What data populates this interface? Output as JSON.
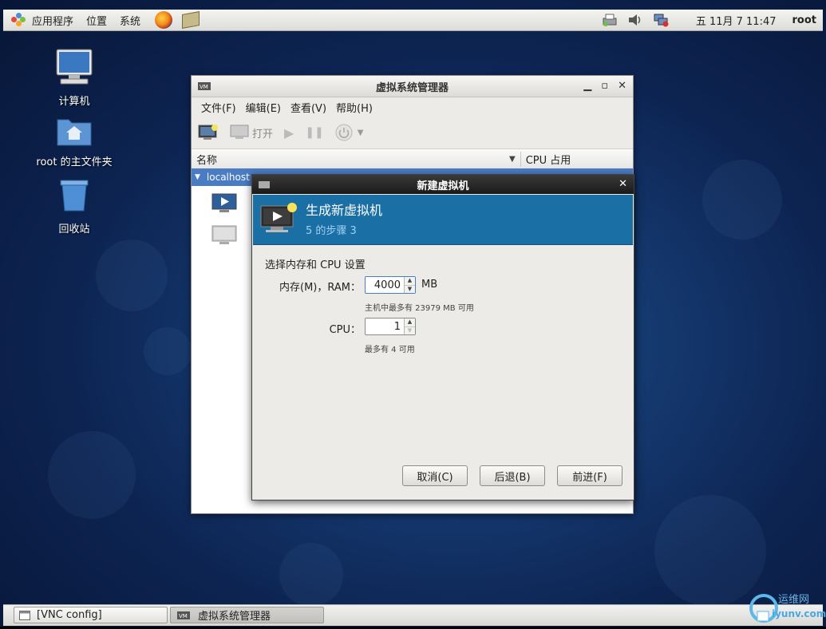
{
  "top_panel": {
    "menus": [
      "应用程序",
      "位置",
      "系统"
    ],
    "clock": "五 11月  7 11:47",
    "user": "root"
  },
  "desktop": {
    "icons": [
      "计算机",
      "root 的主文件夹",
      "回收站"
    ]
  },
  "vmm_window": {
    "title": "虚拟系统管理器",
    "menus": [
      "文件(F)",
      "编辑(E)",
      "查看(V)",
      "帮助(H)"
    ],
    "toolbar_open_label": "打开",
    "columns": {
      "name": "名称",
      "cpu": "CPU 占用"
    },
    "host_name": "localhost"
  },
  "dialog": {
    "title": "新建虚拟机",
    "banner_title": "生成新虚拟机",
    "banner_step": "5 的步骤 3",
    "section_label": "选择内存和 CPU 设置",
    "memory_label": "内存(M)，RAM：",
    "memory_value": "4000",
    "memory_unit": "MB",
    "memory_hint": "主机中最多有 23979 MB 可用",
    "cpu_label": "CPU：",
    "cpu_value": "1",
    "cpu_hint": "最多有 4 可用",
    "cancel_label": "取消(C)",
    "back_label": "后退(B)",
    "forward_label": "前进(F)"
  },
  "taskbar": {
    "tasks": [
      "[VNC config]",
      "虚拟系统管理器"
    ]
  },
  "watermark": {
    "text": "运维网",
    "subtext": "iyunv.com"
  },
  "colors": {
    "banner_blue": "#1a6fa5",
    "selection_blue": "#4a7cc4",
    "desktop_blue": "#153a70"
  }
}
